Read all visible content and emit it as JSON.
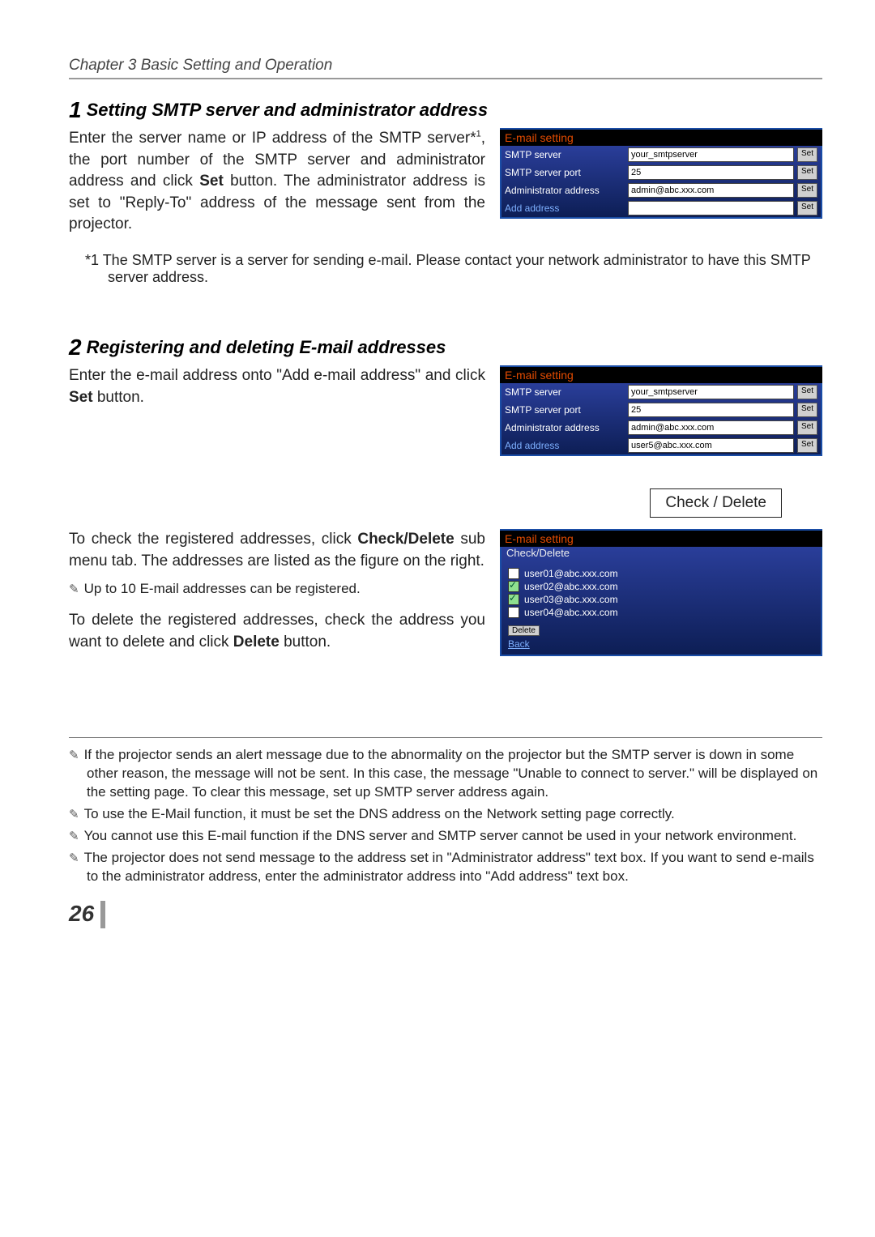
{
  "header": {
    "chapter": "Chapter 3 Basic Setting and Operation"
  },
  "section1": {
    "num": "1",
    "title": "Setting SMTP server and administrator address",
    "body_pre": "Enter the server name or IP address of the SMTP server*",
    "body_sup": "1",
    "body_post": ", the port number of the SMTP server and administrator address and click ",
    "body_set": "Set",
    "body_post2": " button. The administrator address is set to \"Reply-To\" address of the message sent from the projector.",
    "footnote": "*1 The SMTP server is a server for sending e-mail. Please contact your network administrator to have this SMTP server address."
  },
  "panel1": {
    "title": "E-mail setting",
    "rows": [
      {
        "label": "SMTP server",
        "value": "your_smtpserver",
        "btn": "Set",
        "hot": true
      },
      {
        "label": "SMTP server port",
        "value": "25",
        "btn": "Set"
      },
      {
        "label": "Administrator address",
        "value": "admin@abc.xxx.com",
        "btn": "Set"
      },
      {
        "label": "Add address",
        "value": "",
        "btn": "Set",
        "add": true
      }
    ]
  },
  "section2": {
    "num": "2",
    "title": "Registering and deleting E-mail addresses",
    "body_pre": "Enter the e-mail address onto \"Add e-mail address\" and click ",
    "body_set": "Set",
    "body_post": " button.",
    "check_delete_box": "Check / Delete",
    "para2_pre": "To check the registered addresses, click ",
    "para2_b": "Check/Delete",
    "para2_post": " sub menu tab. The addresses are listed as the figure on the right.",
    "note_max": "Up to 10 E-mail addresses can be registered.",
    "para3_pre": "To delete the registered addresses, check the address you want to delete and click ",
    "para3_b": "Delete",
    "para3_post": " button."
  },
  "panel2": {
    "title": "E-mail setting",
    "rows": [
      {
        "label": "SMTP server",
        "value": "your_smtpserver",
        "btn": "Set"
      },
      {
        "label": "SMTP server port",
        "value": "25",
        "btn": "Set"
      },
      {
        "label": "Administrator address",
        "value": "admin@abc.xxx.com",
        "btn": "Set"
      },
      {
        "label": "Add address",
        "value": "user5@abc.xxx.com",
        "btn": "Set",
        "add": true,
        "hot": true
      }
    ]
  },
  "panel3": {
    "title": "E-mail setting",
    "subtitle": "Check/Delete",
    "items": [
      {
        "email": "user01@abc.xxx.com",
        "checked": false
      },
      {
        "email": "user02@abc.xxx.com",
        "checked": true
      },
      {
        "email": "user03@abc.xxx.com",
        "checked": true
      },
      {
        "email": "user04@abc.xxx.com",
        "checked": false
      }
    ],
    "delete_btn": "Delete",
    "back_link": "Back"
  },
  "foot_notes": [
    "If the projector sends an alert message due to the abnormality on the projector but the SMTP server is down in some other reason, the message will not be sent. In this case, the message \"Unable to connect to server.\" will be displayed on the setting page. To clear this message, set up SMTP server address again.",
    "To use the E-Mail function, it must be set the DNS address on the Network setting page correctly.",
    "You cannot use this E-mail function if the DNS server and SMTP server cannot be used in your network environment.",
    "The projector does not send message to the address set in \"Administrator address\" text box. If you want to send e-mails to the administrator address, enter the administrator address into \"Add address\" text box."
  ],
  "page_number": "26"
}
